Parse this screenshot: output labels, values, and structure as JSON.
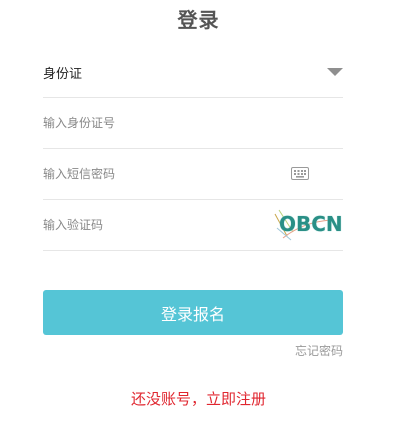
{
  "page": {
    "title": "登录"
  },
  "form": {
    "id_type": {
      "selected": "身份证",
      "icon": "chevron-down-icon"
    },
    "id_number": {
      "placeholder": "输入身份证号",
      "value": ""
    },
    "sms_code": {
      "placeholder": "输入短信密码",
      "value": "",
      "icon": "keyboard-icon"
    },
    "captcha": {
      "placeholder": "输入验证码",
      "value": "",
      "image_text": "OBCN"
    }
  },
  "actions": {
    "submit_label": "登录报名",
    "forgot_label": "忘记密码",
    "register_label": "还没账号，立即注册"
  },
  "colors": {
    "accent": "#55c5d6",
    "register_link": "#e0262f",
    "captcha_text": "#2a8f86"
  }
}
